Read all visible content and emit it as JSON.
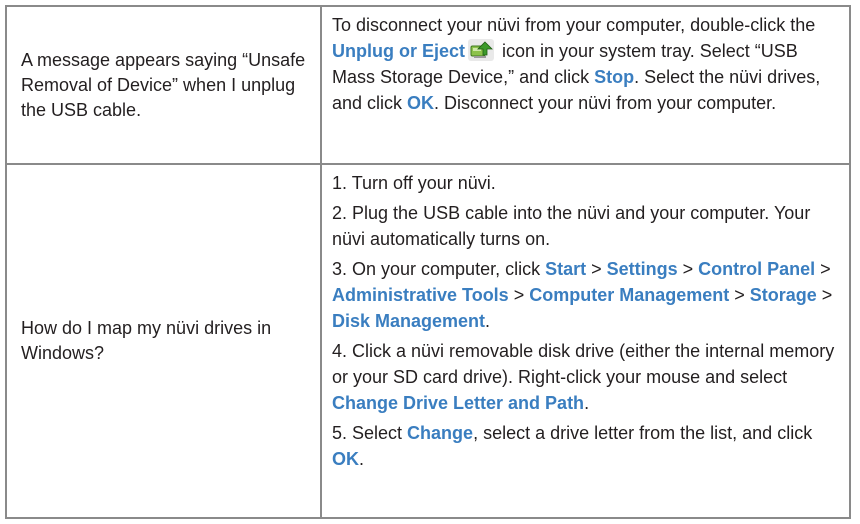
{
  "faq": [
    {
      "question": "A message appears saying “Unsafe Removal of Device” when I unplug the USB cable.",
      "answer": {
        "t1": "To disconnect your nüvi from your computer, double-click the ",
        "k1": "Unplug or Eject",
        "t2": " icon in your system tray. Select “USB Mass Storage Device,” and click ",
        "k2": "Stop",
        "t3": ". Select the nüvi drives, and click ",
        "k3": "OK",
        "t4": ". Disconnect your nüvi from your computer."
      }
    },
    {
      "question": "How do I map my nüvi drives in Windows?",
      "steps": [
        {
          "t1": "1. Turn off your nüvi."
        },
        {
          "t1": "2. Plug the USB cable into the nüvi and your computer. Your nüvi automatically turns on."
        },
        {
          "t1": "3. On your computer, click ",
          "k1": "Start",
          "s1": " > ",
          "k2": "Settings",
          "s2": " > ",
          "k3": "Control Panel",
          "s3": " > ",
          "k4": "Administrative Tools",
          "s4": " > ",
          "k5": "Computer Management",
          "s5": " > ",
          "k6": "Storage",
          "s6": " > ",
          "k7": "Disk Management",
          "s7": "."
        },
        {
          "t1": "4. Click a nüvi removable disk drive (either the internal memory or your SD card drive). Right-click your mouse and select ",
          "k1": "Change Drive Letter and Path",
          "t2": "."
        },
        {
          "t1": "5. Select ",
          "k1": "Change",
          "t2": ", select a drive letter from the list, and click ",
          "k2": "OK",
          "t3": "."
        }
      ]
    }
  ],
  "icons": {
    "tray": "unplug-eject-icon"
  },
  "colors": {
    "keyword": "#3a7ec0",
    "text": "#231f20",
    "border": "#8a8a8a"
  }
}
